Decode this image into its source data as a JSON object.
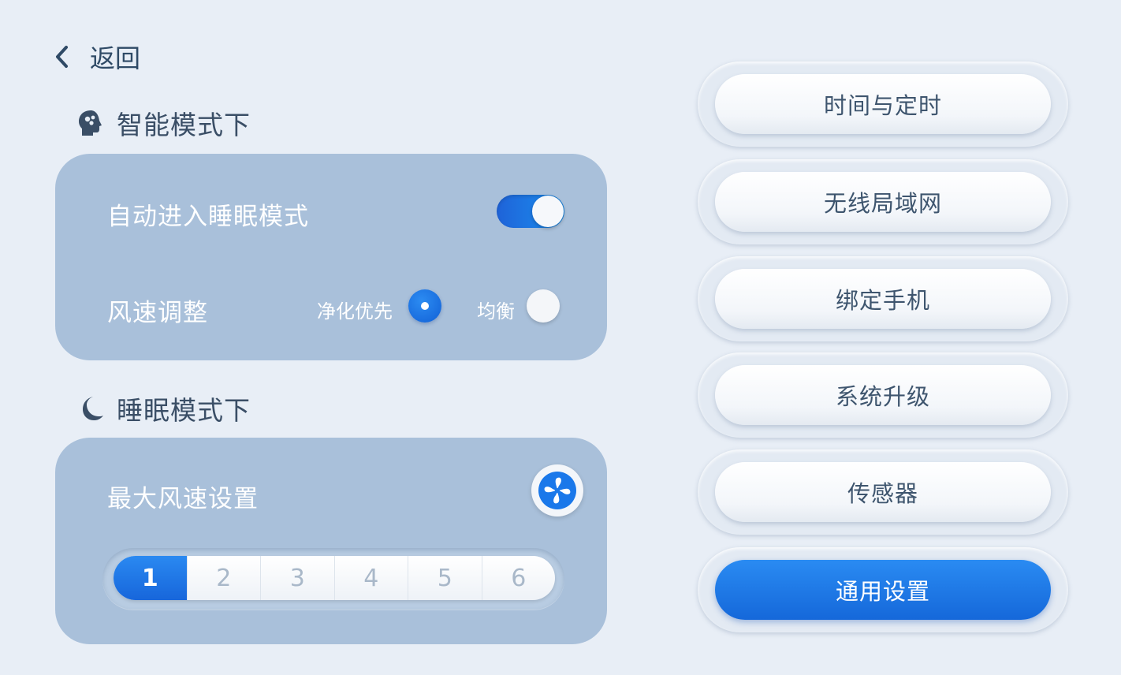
{
  "colors": {
    "accent": "#1a73e8",
    "panel": "#a9c0da",
    "background": "#e8eef6"
  },
  "header": {
    "back_label": "返回",
    "back_icon": "chevron-left-icon"
  },
  "smart_mode": {
    "title": "智能模式下",
    "icon": "head-brain-icon",
    "auto_sleep": {
      "label": "自动进入睡眠模式",
      "enabled": true
    },
    "fan_speed": {
      "label": "风速调整",
      "options": [
        {
          "label": "净化优先",
          "selected": true
        },
        {
          "label": "均衡",
          "selected": false
        }
      ]
    }
  },
  "sleep_mode": {
    "title": "睡眠模式下",
    "icon": "moon-icon",
    "max_speed": {
      "label": "最大风速设置",
      "icon": "fan-icon",
      "levels": [
        "1",
        "2",
        "3",
        "4",
        "5",
        "6"
      ],
      "selected_level": "1"
    }
  },
  "menu": {
    "items": [
      {
        "label": "时间与定时",
        "active": false
      },
      {
        "label": "无线局域网",
        "active": false
      },
      {
        "label": "绑定手机",
        "active": false
      },
      {
        "label": "系统升级",
        "active": false
      },
      {
        "label": "传感器",
        "active": false
      },
      {
        "label": "通用设置",
        "active": true
      }
    ]
  }
}
